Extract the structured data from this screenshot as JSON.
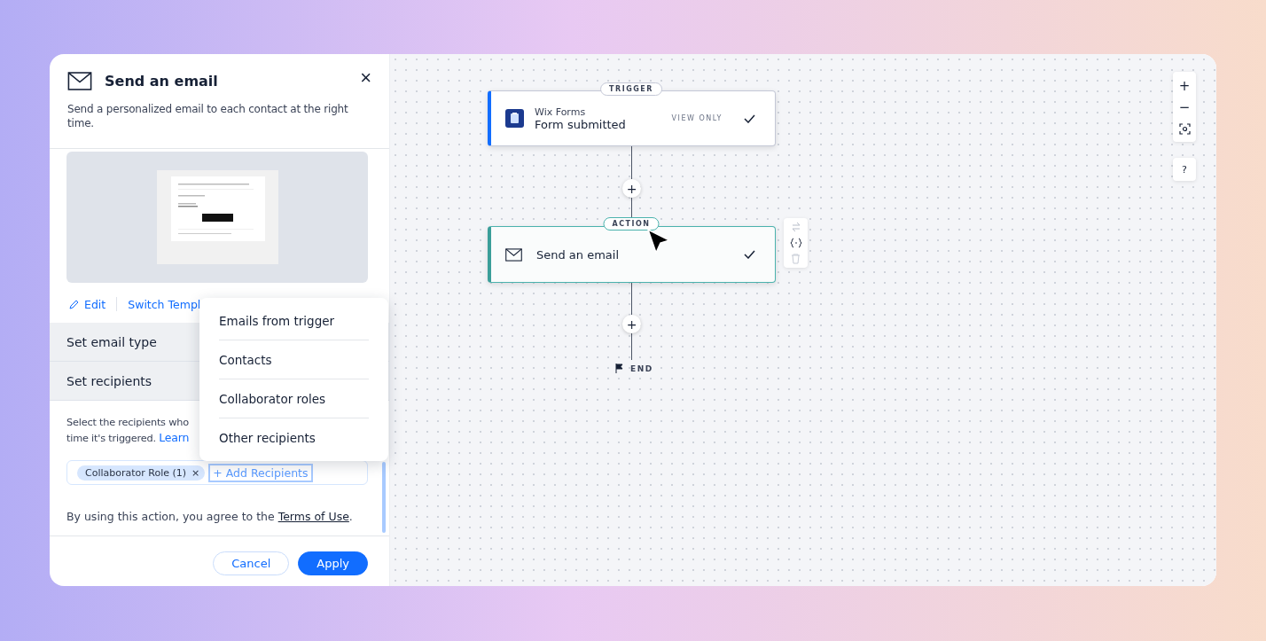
{
  "panel": {
    "title": "Send an email",
    "description": "Send a personalized email to each contact at the right time.",
    "close_label": "×",
    "links": [
      {
        "label": "Edit",
        "kind": "edit"
      },
      {
        "label": "Switch Templ",
        "kind": "plain"
      }
    ],
    "sections": [
      {
        "label": "Set email type"
      },
      {
        "label": "Set recipients"
      }
    ],
    "recipients_text": {
      "line_1": "Select the recipients who",
      "line_2": "time it's triggered.",
      "link": "Learn"
    },
    "recipients_field": {
      "chips": [
        {
          "label": "Collaborator Role (1)",
          "remove": "×"
        }
      ],
      "add_label": "+ Add Recipients"
    },
    "terms": {
      "text": "By using this action, you agree to the",
      "link": "Terms of Use",
      "end": "."
    },
    "buttons": [
      {
        "label": "Cancel",
        "kind": "secondary"
      },
      {
        "label": "Apply",
        "kind": "primary"
      }
    ]
  },
  "menu": {
    "items": [
      {
        "label": "Emails from trigger"
      },
      {
        "label": "Contacts"
      },
      {
        "label": "Collaborator roles"
      },
      {
        "label": "Other recipients"
      }
    ]
  },
  "canvas": {
    "trigger": {
      "badge": "TRIGGER",
      "app": "Wix Forms",
      "title": "Form submitted",
      "status": "VIEW ONLY"
    },
    "action": {
      "badge": "ACTION",
      "title": "Send an email",
      "selected": true
    },
    "add_buttons": [
      "+",
      "+"
    ],
    "end_label": "END",
    "zoom": {
      "in": "+",
      "out": "−"
    },
    "help": "?"
  }
}
